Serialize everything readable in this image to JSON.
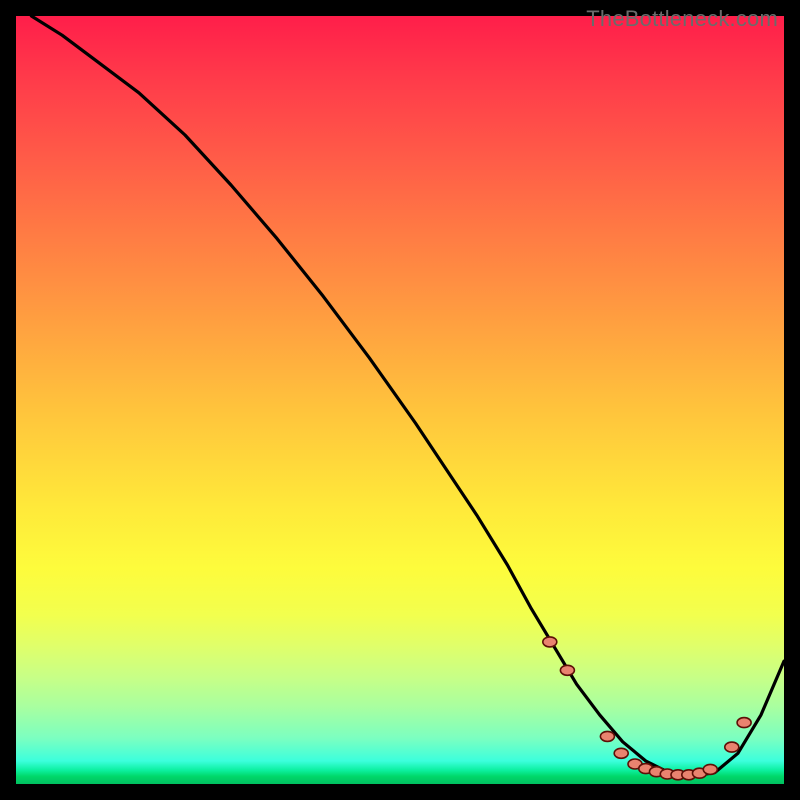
{
  "watermark": "TheBottleneck.com",
  "chart_data": {
    "type": "line",
    "title": "",
    "xlabel": "",
    "ylabel": "",
    "xlim": [
      0,
      100
    ],
    "ylim": [
      0,
      100
    ],
    "grid": false,
    "legend": false,
    "series": [
      {
        "name": "curve",
        "color": "#000000",
        "x": [
          2,
          6,
          10,
          16,
          22,
          28,
          34,
          40,
          46,
          52,
          56,
          60,
          64,
          67,
          70,
          73,
          76,
          79,
          82,
          85,
          88,
          91,
          94,
          97,
          100
        ],
        "y": [
          100,
          97.5,
          94.5,
          90,
          84.5,
          78,
          71,
          63.5,
          55.5,
          47,
          41,
          35,
          28.5,
          23,
          18,
          13,
          9,
          5.5,
          3,
          1.5,
          1,
          1.5,
          4,
          9,
          16
        ]
      }
    ],
    "markers": [
      {
        "x": 69.5,
        "y": 18.5
      },
      {
        "x": 71.8,
        "y": 14.8
      },
      {
        "x": 77.0,
        "y": 6.2
      },
      {
        "x": 78.8,
        "y": 4.0
      },
      {
        "x": 80.6,
        "y": 2.6
      },
      {
        "x": 82.0,
        "y": 2.0
      },
      {
        "x": 83.4,
        "y": 1.6
      },
      {
        "x": 84.8,
        "y": 1.3
      },
      {
        "x": 86.2,
        "y": 1.2
      },
      {
        "x": 87.6,
        "y": 1.2
      },
      {
        "x": 89.0,
        "y": 1.4
      },
      {
        "x": 90.4,
        "y": 1.9
      },
      {
        "x": 93.2,
        "y": 4.8
      },
      {
        "x": 94.8,
        "y": 8.0
      }
    ],
    "marker_style": {
      "fill": "#e9836f",
      "stroke": "#5e0f07",
      "rx": 7,
      "ry": 5
    },
    "background_gradient": [
      {
        "stop": 0.0,
        "color": "#ff1e4a"
      },
      {
        "stop": 0.5,
        "color": "#ffc63c"
      },
      {
        "stop": 0.75,
        "color": "#fdfc3c"
      },
      {
        "stop": 0.95,
        "color": "#7cffc0"
      },
      {
        "stop": 1.0,
        "color": "#00c060"
      }
    ]
  }
}
